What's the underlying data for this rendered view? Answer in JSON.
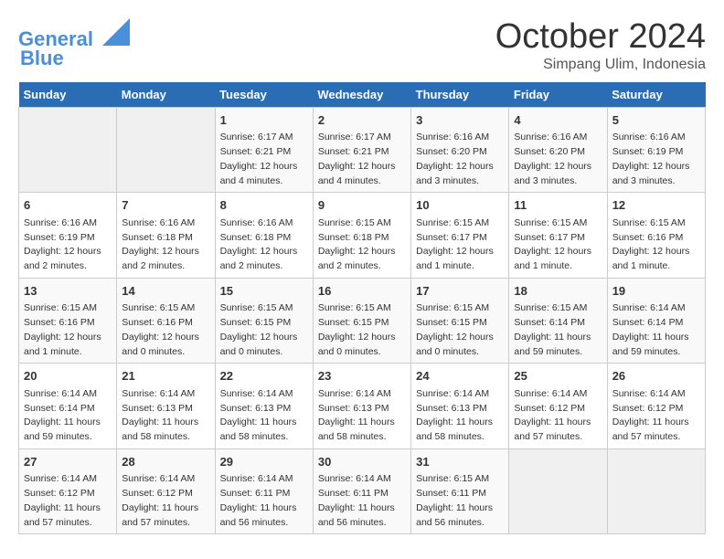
{
  "header": {
    "logo_line1": "General",
    "logo_line2": "Blue",
    "title": "October 2024",
    "location": "Simpang Ulim, Indonesia"
  },
  "days_of_week": [
    "Sunday",
    "Monday",
    "Tuesday",
    "Wednesday",
    "Thursday",
    "Friday",
    "Saturday"
  ],
  "weeks": [
    [
      {
        "day": "",
        "empty": true
      },
      {
        "day": "",
        "empty": true
      },
      {
        "day": "1",
        "sunrise": "6:17 AM",
        "sunset": "6:21 PM",
        "daylight": "12 hours and 4 minutes."
      },
      {
        "day": "2",
        "sunrise": "6:17 AM",
        "sunset": "6:21 PM",
        "daylight": "12 hours and 4 minutes."
      },
      {
        "day": "3",
        "sunrise": "6:16 AM",
        "sunset": "6:20 PM",
        "daylight": "12 hours and 3 minutes."
      },
      {
        "day": "4",
        "sunrise": "6:16 AM",
        "sunset": "6:20 PM",
        "daylight": "12 hours and 3 minutes."
      },
      {
        "day": "5",
        "sunrise": "6:16 AM",
        "sunset": "6:19 PM",
        "daylight": "12 hours and 3 minutes."
      }
    ],
    [
      {
        "day": "6",
        "sunrise": "6:16 AM",
        "sunset": "6:19 PM",
        "daylight": "12 hours and 2 minutes."
      },
      {
        "day": "7",
        "sunrise": "6:16 AM",
        "sunset": "6:18 PM",
        "daylight": "12 hours and 2 minutes."
      },
      {
        "day": "8",
        "sunrise": "6:16 AM",
        "sunset": "6:18 PM",
        "daylight": "12 hours and 2 minutes."
      },
      {
        "day": "9",
        "sunrise": "6:15 AM",
        "sunset": "6:18 PM",
        "daylight": "12 hours and 2 minutes."
      },
      {
        "day": "10",
        "sunrise": "6:15 AM",
        "sunset": "6:17 PM",
        "daylight": "12 hours and 1 minute."
      },
      {
        "day": "11",
        "sunrise": "6:15 AM",
        "sunset": "6:17 PM",
        "daylight": "12 hours and 1 minute."
      },
      {
        "day": "12",
        "sunrise": "6:15 AM",
        "sunset": "6:16 PM",
        "daylight": "12 hours and 1 minute."
      }
    ],
    [
      {
        "day": "13",
        "sunrise": "6:15 AM",
        "sunset": "6:16 PM",
        "daylight": "12 hours and 1 minute."
      },
      {
        "day": "14",
        "sunrise": "6:15 AM",
        "sunset": "6:16 PM",
        "daylight": "12 hours and 0 minutes."
      },
      {
        "day": "15",
        "sunrise": "6:15 AM",
        "sunset": "6:15 PM",
        "daylight": "12 hours and 0 minutes."
      },
      {
        "day": "16",
        "sunrise": "6:15 AM",
        "sunset": "6:15 PM",
        "daylight": "12 hours and 0 minutes."
      },
      {
        "day": "17",
        "sunrise": "6:15 AM",
        "sunset": "6:15 PM",
        "daylight": "12 hours and 0 minutes."
      },
      {
        "day": "18",
        "sunrise": "6:15 AM",
        "sunset": "6:14 PM",
        "daylight": "11 hours and 59 minutes."
      },
      {
        "day": "19",
        "sunrise": "6:14 AM",
        "sunset": "6:14 PM",
        "daylight": "11 hours and 59 minutes."
      }
    ],
    [
      {
        "day": "20",
        "sunrise": "6:14 AM",
        "sunset": "6:14 PM",
        "daylight": "11 hours and 59 minutes."
      },
      {
        "day": "21",
        "sunrise": "6:14 AM",
        "sunset": "6:13 PM",
        "daylight": "11 hours and 58 minutes."
      },
      {
        "day": "22",
        "sunrise": "6:14 AM",
        "sunset": "6:13 PM",
        "daylight": "11 hours and 58 minutes."
      },
      {
        "day": "23",
        "sunrise": "6:14 AM",
        "sunset": "6:13 PM",
        "daylight": "11 hours and 58 minutes."
      },
      {
        "day": "24",
        "sunrise": "6:14 AM",
        "sunset": "6:13 PM",
        "daylight": "11 hours and 58 minutes."
      },
      {
        "day": "25",
        "sunrise": "6:14 AM",
        "sunset": "6:12 PM",
        "daylight": "11 hours and 57 minutes."
      },
      {
        "day": "26",
        "sunrise": "6:14 AM",
        "sunset": "6:12 PM",
        "daylight": "11 hours and 57 minutes."
      }
    ],
    [
      {
        "day": "27",
        "sunrise": "6:14 AM",
        "sunset": "6:12 PM",
        "daylight": "11 hours and 57 minutes."
      },
      {
        "day": "28",
        "sunrise": "6:14 AM",
        "sunset": "6:12 PM",
        "daylight": "11 hours and 57 minutes."
      },
      {
        "day": "29",
        "sunrise": "6:14 AM",
        "sunset": "6:11 PM",
        "daylight": "11 hours and 56 minutes."
      },
      {
        "day": "30",
        "sunrise": "6:14 AM",
        "sunset": "6:11 PM",
        "daylight": "11 hours and 56 minutes."
      },
      {
        "day": "31",
        "sunrise": "6:15 AM",
        "sunset": "6:11 PM",
        "daylight": "11 hours and 56 minutes."
      },
      {
        "day": "",
        "empty": true
      },
      {
        "day": "",
        "empty": true
      }
    ]
  ]
}
